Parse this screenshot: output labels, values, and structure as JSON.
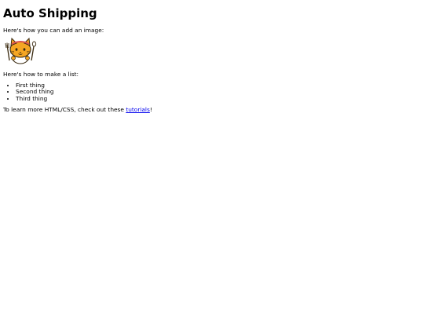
{
  "page": {
    "title": "Auto Shipping",
    "image_intro": "Here's how you can add an image:",
    "mascot_icon": "cat-chef-mascot",
    "list_intro": "Here's how to make a list:",
    "list_items": [
      "First thing",
      "Second thing",
      "Third thing"
    ],
    "outro_prefix": "To learn more HTML/CSS, check out these ",
    "outro_link": "tutorials",
    "outro_suffix": "!"
  },
  "colors": {
    "link": "#0000ee",
    "mascot_fill": "#f5a623",
    "mascot_outline": "#3a2a10"
  }
}
